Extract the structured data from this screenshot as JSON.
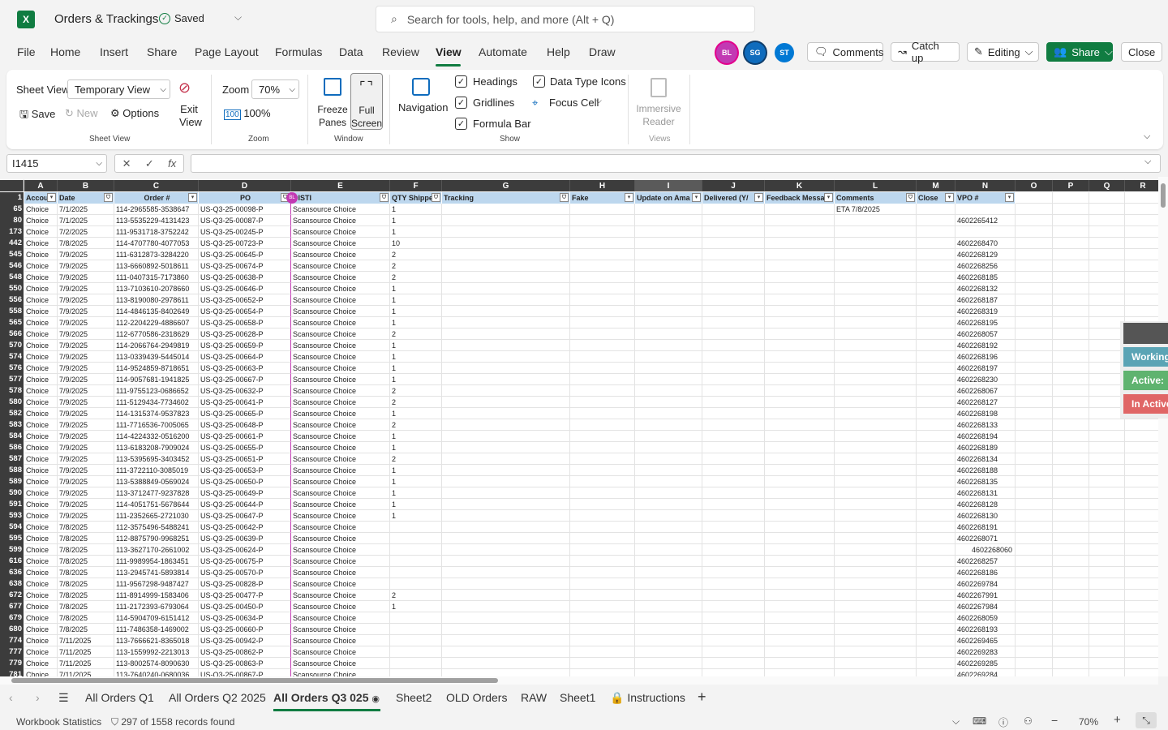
{
  "app": {
    "logo": "X",
    "title": "Orders & Trackings",
    "saved": "Saved",
    "search_placeholder": "Search for tools, help, and more (Alt + Q)"
  },
  "menu": [
    "File",
    "Home",
    "Insert",
    "Share",
    "Page Layout",
    "Formulas",
    "Data",
    "Review",
    "View",
    "Automate",
    "Help",
    "Draw"
  ],
  "active_menu": "View",
  "avatars": [
    {
      "initials": "BL",
      "color": "#c239b3"
    },
    {
      "initials": "SG",
      "color": "#0f6cbd"
    },
    {
      "initials": "ST",
      "color": "#0078d4"
    }
  ],
  "header_buttons": {
    "comments": "Comments",
    "catch_up": "Catch up",
    "editing": "Editing",
    "share": "Share",
    "close": "Close"
  },
  "ribbon": {
    "sheet_view_label": "Sheet View",
    "sheet_view_value": "Temporary View",
    "save": "Save",
    "new": "New",
    "options": "Options",
    "exit_view": "Exit View",
    "group_sheet_view": "Sheet View",
    "zoom_label": "Zoom",
    "zoom_value": "70%",
    "zoom100": "100%",
    "group_zoom": "Zoom",
    "freeze_panes": "Freeze Panes",
    "full_screen": "Full Screen",
    "group_window": "Window",
    "navigation": "Navigation",
    "headings": "Headings",
    "gridlines": "Gridlines",
    "formula_bar": "Formula Bar",
    "data_type_icons": "Data Type Icons",
    "focus_cell": "Focus Cell",
    "group_show": "Show",
    "immersive_reader": "Immersive Reader",
    "group_views": "Views"
  },
  "formula_bar": {
    "name_box": "I1415",
    "formula": ""
  },
  "columns": [
    "A",
    "B",
    "C",
    "D",
    "E",
    "F",
    "G",
    "H",
    "I",
    "J",
    "K",
    "L",
    "M",
    "N",
    "O",
    "P",
    "Q",
    "R"
  ],
  "headers": [
    "Accou",
    "Date",
    "Order #",
    "PO",
    "DISTI",
    "QTY Shippe",
    "Tracking",
    "Fake",
    "Update on Ama",
    "Delivered (Y/",
    "Feedback Messa",
    "Comments",
    "Close",
    "VPO #"
  ],
  "rows": [
    [
      "65",
      "Choice",
      "7/1/2025",
      "114-2965585-3538647",
      "US-Q3-25-00098-P",
      "Scansource Choice",
      "1",
      "ETA 7/8/2025",
      ""
    ],
    [
      "80",
      "Choice",
      "7/1/2025",
      "113-5535229-4131423",
      "US-Q3-25-00087-P",
      "Scansource Choice",
      "1",
      "",
      "4602265412"
    ],
    [
      "173",
      "Choice",
      "7/2/2025",
      "111-9531718-3752242",
      "US-Q3-25-00245-P",
      "Scansource Choice",
      "1",
      "",
      ""
    ],
    [
      "442",
      "Choice",
      "7/8/2025",
      "114-4707780-4077053",
      "US-Q3-25-00723-P",
      "Scansource Choice",
      "10",
      "",
      "4602268470"
    ],
    [
      "545",
      "Choice",
      "7/9/2025",
      "111-6312873-3284220",
      "US-Q3-25-00645-P",
      "Scansource Choice",
      "2",
      "",
      "4602268129"
    ],
    [
      "546",
      "Choice",
      "7/9/2025",
      "113-6660892-5018611",
      "US-Q3-25-00674-P",
      "Scansource Choice",
      "2",
      "",
      "4602268256"
    ],
    [
      "548",
      "Choice",
      "7/9/2025",
      "111-0407315-7173860",
      "US-Q3-25-00638-P",
      "Scansource Choice",
      "2",
      "",
      "4602268185"
    ],
    [
      "550",
      "Choice",
      "7/9/2025",
      "113-7103610-2078660",
      "US-Q3-25-00646-P",
      "Scansource Choice",
      "1",
      "",
      "4602268132"
    ],
    [
      "556",
      "Choice",
      "7/9/2025",
      "113-8190080-2978611",
      "US-Q3-25-00652-P",
      "Scansource Choice",
      "1",
      "",
      "4602268187"
    ],
    [
      "558",
      "Choice",
      "7/9/2025",
      "114-4846135-8402649",
      "US-Q3-25-00654-P",
      "Scansource Choice",
      "1",
      "",
      "4602268319"
    ],
    [
      "565",
      "Choice",
      "7/9/2025",
      "112-2204229-4886607",
      "US-Q3-25-00658-P",
      "Scansource Choice",
      "1",
      "",
      "4602268195"
    ],
    [
      "566",
      "Choice",
      "7/9/2025",
      "112-6770586-2318629",
      "US-Q3-25-00628-P",
      "Scansource Choice",
      "2",
      "",
      "4602268057"
    ],
    [
      "570",
      "Choice",
      "7/9/2025",
      "114-2066764-2949819",
      "US-Q3-25-00659-P",
      "Scansource Choice",
      "1",
      "",
      "4602268192"
    ],
    [
      "574",
      "Choice",
      "7/9/2025",
      "113-0339439-5445014",
      "US-Q3-25-00664-P",
      "Scansource Choice",
      "1",
      "",
      "4602268196"
    ],
    [
      "576",
      "Choice",
      "7/9/2025",
      "114-9524859-8718651",
      "US-Q3-25-00663-P",
      "Scansource Choice",
      "1",
      "",
      "4602268197"
    ],
    [
      "577",
      "Choice",
      "7/9/2025",
      "114-9057681-1941825",
      "US-Q3-25-00667-P",
      "Scansource Choice",
      "1",
      "",
      "4602268230"
    ],
    [
      "578",
      "Choice",
      "7/9/2025",
      "111-9755123-0686652",
      "US-Q3-25-00632-P",
      "Scansource Choice",
      "2",
      "",
      "4602268067"
    ],
    [
      "580",
      "Choice",
      "7/9/2025",
      "111-5129434-7734602",
      "US-Q3-25-00641-P",
      "Scansource Choice",
      "2",
      "",
      "4602268127"
    ],
    [
      "582",
      "Choice",
      "7/9/2025",
      "114-1315374-9537823",
      "US-Q3-25-00665-P",
      "Scansource Choice",
      "1",
      "",
      "4602268198"
    ],
    [
      "583",
      "Choice",
      "7/9/2025",
      "111-7716536-7005065",
      "US-Q3-25-00648-P",
      "Scansource Choice",
      "2",
      "",
      "4602268133"
    ],
    [
      "584",
      "Choice",
      "7/9/2025",
      "114-4224332-0516200",
      "US-Q3-25-00661-P",
      "Scansource Choice",
      "1",
      "",
      "4602268194"
    ],
    [
      "586",
      "Choice",
      "7/9/2025",
      "113-6183208-7909024",
      "US-Q3-25-00655-P",
      "Scansource Choice",
      "1",
      "",
      "4602268189"
    ],
    [
      "587",
      "Choice",
      "7/9/2025",
      "113-5395695-3403452",
      "US-Q3-25-00651-P",
      "Scansource Choice",
      "2",
      "",
      "4602268134"
    ],
    [
      "588",
      "Choice",
      "7/9/2025",
      "111-3722110-3085019",
      "US-Q3-25-00653-P",
      "Scansource Choice",
      "1",
      "",
      "4602268188"
    ],
    [
      "589",
      "Choice",
      "7/9/2025",
      "113-5388849-0569024",
      "US-Q3-25-00650-P",
      "Scansource Choice",
      "1",
      "",
      "4602268135"
    ],
    [
      "590",
      "Choice",
      "7/9/2025",
      "113-3712477-9237828",
      "US-Q3-25-00649-P",
      "Scansource Choice",
      "1",
      "",
      "4602268131"
    ],
    [
      "591",
      "Choice",
      "7/9/2025",
      "114-4051751-5678644",
      "US-Q3-25-00644-P",
      "Scansource Choice",
      "1",
      "",
      "4602268128"
    ],
    [
      "593",
      "Choice",
      "7/9/2025",
      "111-2352665-2721030",
      "US-Q3-25-00647-P",
      "Scansource Choice",
      "1",
      "",
      "4602268130"
    ],
    [
      "594",
      "Choice",
      "7/8/2025",
      "112-3575496-5488241",
      "US-Q3-25-00642-P",
      "Scansource Choice",
      "",
      "",
      "4602268191"
    ],
    [
      "595",
      "Choice",
      "7/8/2025",
      "112-8875790-9968251",
      "US-Q3-25-00639-P",
      "Scansource Choice",
      "",
      "",
      "4602268071"
    ],
    [
      "599",
      "Choice",
      "7/8/2025",
      "113-3627170-2661002",
      "US-Q3-25-00624-P",
      "Scansource Choice",
      "",
      "",
      "4602268060"
    ],
    [
      "616",
      "Choice",
      "7/8/2025",
      "111-9989954-1863451",
      "US-Q3-25-00675-P",
      "Scansource Choice",
      "",
      "",
      "4602268257"
    ],
    [
      "636",
      "Choice",
      "7/8/2025",
      "113-2945741-5893814",
      "US-Q3-25-00570-P",
      "Scansource Choice",
      "",
      "",
      "4602268186"
    ],
    [
      "638",
      "Choice",
      "7/8/2025",
      "111-9567298-9487427",
      "US-Q3-25-00828-P",
      "Scansource Choice",
      "",
      "",
      "4602269784"
    ],
    [
      "672",
      "Choice",
      "7/8/2025",
      "111-8914999-1583406",
      "US-Q3-25-00477-P",
      "Scansource Choice",
      "2",
      "",
      "4602267991"
    ],
    [
      "677",
      "Choice",
      "7/8/2025",
      "111-2172393-6793064",
      "US-Q3-25-00450-P",
      "Scansource Choice",
      "1",
      "",
      "4602267984"
    ],
    [
      "679",
      "Choice",
      "7/8/2025",
      "114-5904709-6151412",
      "US-Q3-25-00634-P",
      "Scansource Choice",
      "",
      "",
      "4602268059"
    ],
    [
      "680",
      "Choice",
      "7/8/2025",
      "111-7486358-1469002",
      "US-Q3-25-00660-P",
      "Scansource Choice",
      "",
      "",
      "4602268193"
    ],
    [
      "774",
      "Choice",
      "7/11/2025",
      "113-7666621-8365018",
      "US-Q3-25-00942-P",
      "Scansource Choice",
      "",
      "",
      "4602269465"
    ],
    [
      "777",
      "Choice",
      "7/11/2025",
      "113-1559992-2213013",
      "US-Q3-25-00862-P",
      "Scansource Choice",
      "",
      "",
      "4602269283"
    ],
    [
      "779",
      "Choice",
      "7/11/2025",
      "113-8002574-8090630",
      "US-Q3-25-00863-P",
      "Scansource Choice",
      "",
      "",
      "4602269285"
    ],
    [
      "781",
      "Choice",
      "7/11/2025",
      "113-7640240-0680036",
      "US-Q3-25-00867-P",
      "Scansource Choice",
      "",
      "",
      "4602269284"
    ]
  ],
  "side_buttons": [
    {
      "label": "Working",
      "color": "#5ba4b5"
    },
    {
      "label": "Active: C",
      "color": "#5fb36f"
    },
    {
      "label": "In Active",
      "color": "#e06666"
    }
  ],
  "sheet_tabs": [
    "All Orders Q1",
    "All Orders Q2 2025",
    "All Orders Q3 025",
    "Sheet2",
    "OLD Orders",
    "RAW",
    "Sheet1",
    "Instructions"
  ],
  "active_tab": "All Orders Q3 025",
  "status": {
    "workbook_stats": "Workbook Statistics",
    "records": "297 of 1558 records found",
    "zoom": "70%"
  }
}
